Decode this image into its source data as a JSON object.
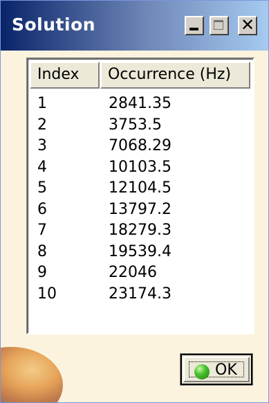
{
  "window": {
    "title": "Solution",
    "controls": {
      "minimize_icon": "minimize-icon",
      "maximize_icon": "maximize-icon",
      "close_icon": "close-icon",
      "close_glyph": "✕"
    }
  },
  "table": {
    "columns": [
      "Index",
      "Occurrence (Hz)"
    ],
    "rows": [
      {
        "index": "1",
        "occurrence": "2841.35"
      },
      {
        "index": "2",
        "occurrence": "3753.5"
      },
      {
        "index": "3",
        "occurrence": "7068.29"
      },
      {
        "index": "4",
        "occurrence": "10103.5"
      },
      {
        "index": "5",
        "occurrence": "12104.5"
      },
      {
        "index": "6",
        "occurrence": "13797.2"
      },
      {
        "index": "7",
        "occurrence": "18279.3"
      },
      {
        "index": "8",
        "occurrence": "19539.4"
      },
      {
        "index": "9",
        "occurrence": "22046"
      },
      {
        "index": "10",
        "occurrence": "23174.3"
      }
    ]
  },
  "ok_button": {
    "label": "OK",
    "icon": "green-ball-icon"
  },
  "colors": {
    "title_bar_start": "#0a246a",
    "title_bar_end": "#a6caf0",
    "dialog_background": "#fbf3dd"
  }
}
